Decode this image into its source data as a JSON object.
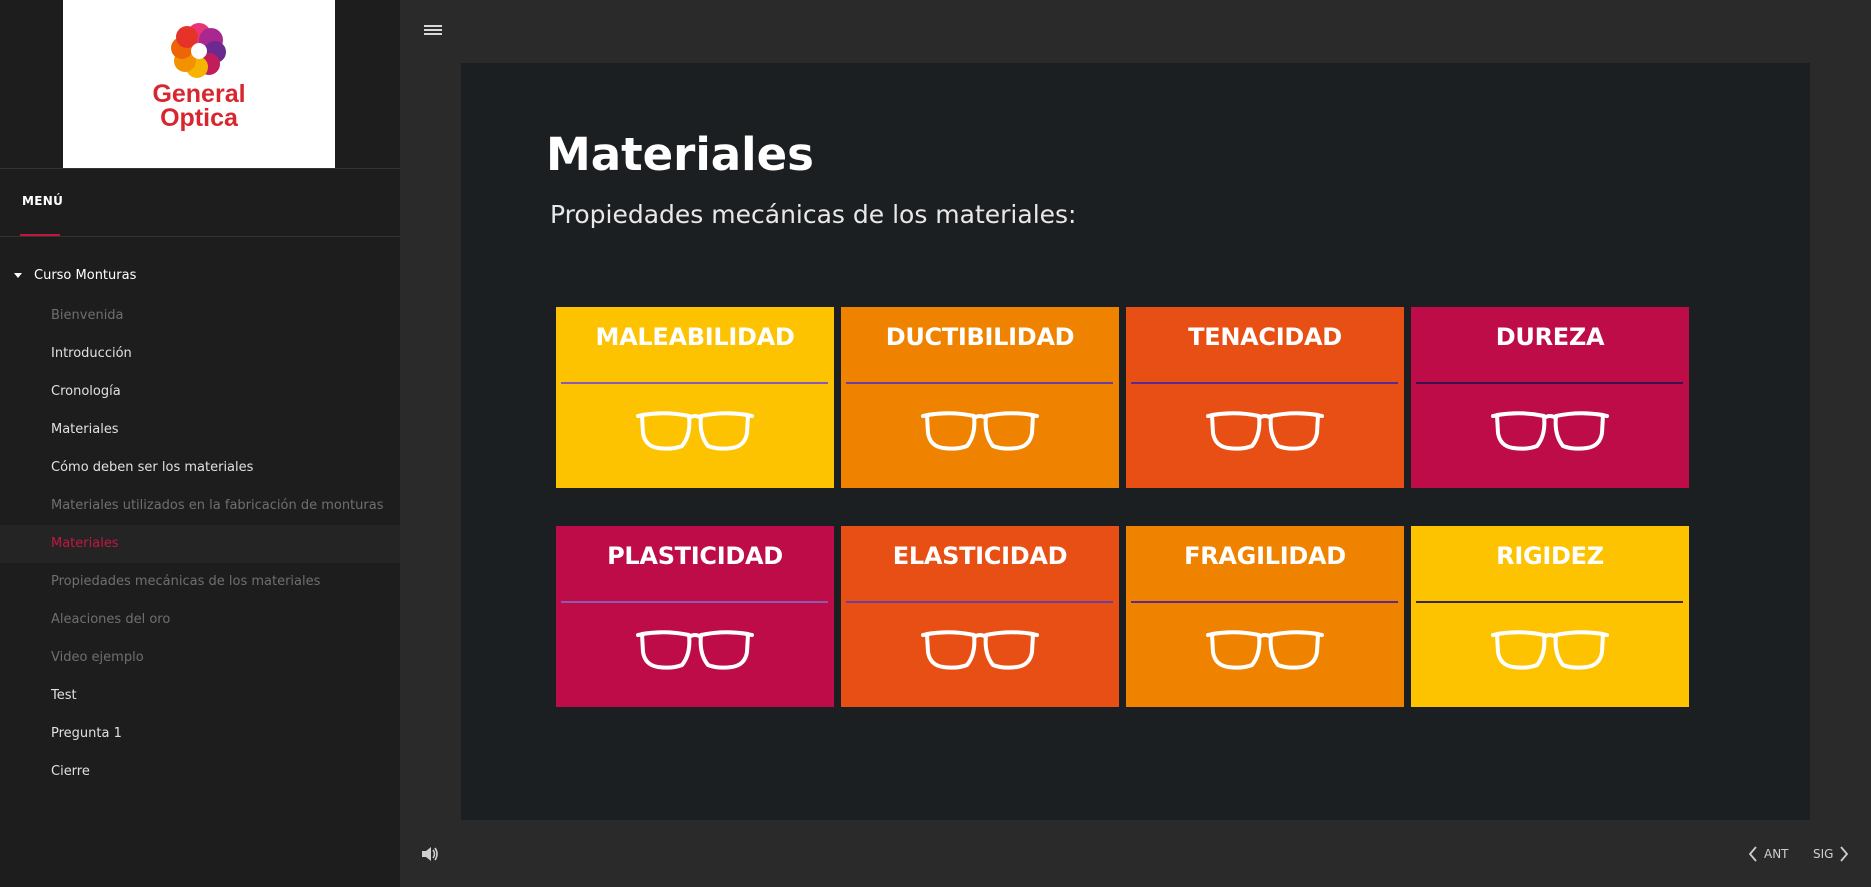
{
  "app": {
    "logo_line1": "General",
    "logo_line2": "Optica",
    "brand_color": "#d8262f",
    "accent_color": "#c0183f"
  },
  "sidebar": {
    "menu_label": "MENÚ",
    "course_title": "Curso Monturas",
    "items": [
      {
        "label": "Bienvenida",
        "state": "dim"
      },
      {
        "label": "Introducción",
        "state": "normal"
      },
      {
        "label": "Cronología",
        "state": "normal"
      },
      {
        "label": "Materiales",
        "state": "normal"
      },
      {
        "label": "Cómo deben ser los materiales",
        "state": "normal"
      },
      {
        "label": "Materiales utilizados en la fabricación de monturas",
        "state": "dim"
      },
      {
        "label": "Materiales",
        "state": "active"
      },
      {
        "label": "Propiedades mecánicas de los materiales",
        "state": "dim"
      },
      {
        "label": "Aleaciones del oro",
        "state": "dim"
      },
      {
        "label": "Video ejemplo",
        "state": "dim"
      },
      {
        "label": "Test",
        "state": "normal"
      },
      {
        "label": "Pregunta 1",
        "state": "normal"
      },
      {
        "label": "Cierre",
        "state": "normal"
      }
    ]
  },
  "slide": {
    "title": "Materiales",
    "subtitle": "Propiedades mecánicas de los materiales:",
    "tiles": [
      {
        "label": "MALEABILIDAD",
        "color": "#fdc300",
        "line_color": "#8a5bb4",
        "icon": "glasses-icon"
      },
      {
        "label": "DUCTIBILIDAD",
        "color": "#ef8300",
        "line_color": "#6b3fa0",
        "icon": "glasses-icon"
      },
      {
        "label": "TENACIDAD",
        "color": "#e74f14",
        "line_color": "#5b2a8f",
        "icon": "glasses-icon"
      },
      {
        "label": "DUREZA",
        "color": "#bd0c48",
        "line_color": "#3b1050",
        "icon": "glasses-icon"
      },
      {
        "label": "PLASTICIDAD",
        "color": "#bd0c48",
        "line_color": "#8a5bb4",
        "icon": "glasses-icon"
      },
      {
        "label": "ELASTICIDAD",
        "color": "#e74f14",
        "line_color": "#6b3fa0",
        "icon": "glasses-icon"
      },
      {
        "label": "FRAGILIDAD",
        "color": "#ef8300",
        "line_color": "#5b2a8f",
        "icon": "glasses-icon"
      },
      {
        "label": "RIGIDEZ",
        "color": "#fdc300",
        "line_color": "#3a2a30",
        "icon": "glasses-icon"
      }
    ]
  },
  "footer": {
    "prev_label": "ANT",
    "next_label": "SIG",
    "audio_icon": "speaker-icon",
    "menu_icon": "hamburger-icon"
  }
}
